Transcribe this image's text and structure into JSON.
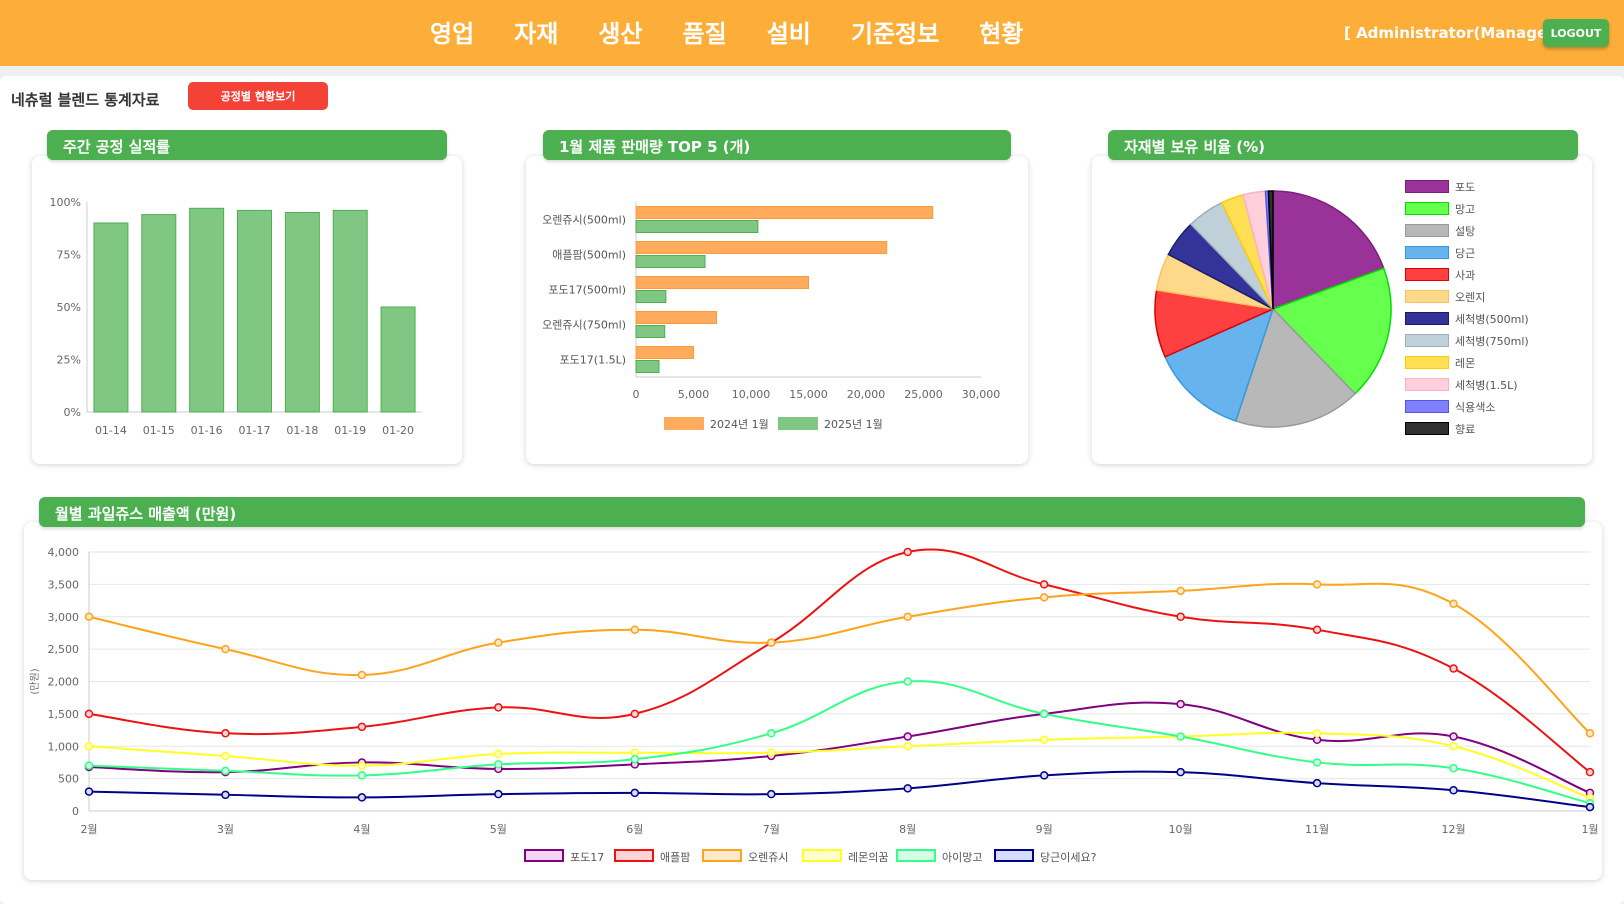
{
  "nav": [
    "영업",
    "자재",
    "생산",
    "품질",
    "설비",
    "기준정보",
    "현황"
  ],
  "user": "[ Administrator(Manager) ]",
  "logout_label": "LOGOUT",
  "page_title": "네츄럴 블렌드 통계자료",
  "process_button_label": "공정별 현황보기",
  "chart_data": [
    {
      "type": "bar",
      "title": "주간 공정 실적률",
      "categories": [
        "01-14",
        "01-15",
        "01-16",
        "01-17",
        "01-18",
        "01-19",
        "01-20"
      ],
      "values": [
        90,
        94,
        97,
        96,
        95,
        96,
        50
      ],
      "ylim": [
        0,
        100
      ],
      "yticks": [
        "0%",
        "25%",
        "50%",
        "75%",
        "100%"
      ],
      "color": "#81c784",
      "edge_color": "#4caf50",
      "grid": false
    },
    {
      "type": "bar",
      "orientation": "horizontal",
      "title": "1월 제품 판매량 TOP 5 (개)",
      "categories": [
        "오렌쥬시(500ml)",
        "애플팜(500ml)",
        "포도17(500ml)",
        "오렌쥬시(750ml)",
        "포도17(1.5L)"
      ],
      "series": [
        {
          "name": "2024년 1월",
          "color": "#ffab5e",
          "values": [
            25800,
            21800,
            15000,
            7000,
            5000
          ]
        },
        {
          "name": "2025년 1월",
          "color": "#81c784",
          "values": [
            10600,
            6000,
            2600,
            2500,
            2000
          ]
        }
      ],
      "xlim": [
        0,
        30000
      ],
      "xticks": [
        "0",
        "5,000",
        "10,000",
        "15,000",
        "20,000",
        "25,000",
        "30,000"
      ],
      "legend": "bottom"
    },
    {
      "type": "pie",
      "title": "자재별 보유 비율 (%)",
      "labels": [
        "포도",
        "망고",
        "설탕",
        "당근",
        "사과",
        "오렌지",
        "세척병(500ml)",
        "세척병(750ml)",
        "레몬",
        "세척병(1.5L)",
        "식용색소",
        "향료"
      ],
      "values": [
        19,
        18,
        17,
        13,
        9,
        5,
        5,
        5,
        3,
        3,
        0.4,
        0.6
      ],
      "colors": [
        "#993399",
        "#66ff4d",
        "#b8b8b8",
        "#66b3ee",
        "#ff4040",
        "#ffd98a",
        "#333399",
        "#c0d0d8",
        "#ffe055",
        "#ffd0dc",
        "#8080ff",
        "#303030"
      ],
      "edge_colors": [
        "#7a1f7a",
        "#00dd00",
        "#9a9a9a",
        "#3399dd",
        "#dd0000",
        "#ffc060",
        "#1a1a66",
        "#9ab0bb",
        "#ffcc00",
        "#ffb0c4",
        "#5555ee",
        "#000000"
      ],
      "legend": "right"
    },
    {
      "type": "line",
      "title": "월별 과일쥬스 매출액 (만원)",
      "ylabel": "(만원)",
      "x": [
        "2월",
        "3월",
        "4월",
        "5월",
        "6월",
        "7월",
        "8월",
        "9월",
        "10월",
        "11월",
        "12월",
        "1월"
      ],
      "ylim": [
        0,
        4000
      ],
      "yticks": [
        "0",
        "500",
        "1,000",
        "1,500",
        "2,000",
        "2,500",
        "3,000",
        "3,500",
        "4,000"
      ],
      "series": [
        {
          "name": "포도17",
          "color": "#800080",
          "fill": "#f6d4f6",
          "values": [
            680,
            600,
            750,
            650,
            720,
            850,
            1150,
            1500,
            1650,
            1100,
            1150,
            280
          ]
        },
        {
          "name": "애플팜",
          "color": "#ee1111",
          "fill": "#ffd4d4",
          "values": [
            1500,
            1200,
            1300,
            1600,
            1500,
            2600,
            4000,
            3500,
            3000,
            2800,
            2200,
            600
          ]
        },
        {
          "name": "오렌쥬시",
          "color": "#ffa31a",
          "fill": "#ffe8cc",
          "values": [
            3000,
            2500,
            2100,
            2600,
            2800,
            2600,
            3000,
            3300,
            3400,
            3500,
            3200,
            1200
          ]
        },
        {
          "name": "레몬의꿈",
          "color": "#ffff22",
          "fill": "#ffffcc",
          "values": [
            1000,
            850,
            700,
            880,
            900,
            900,
            1000,
            1100,
            1150,
            1200,
            1000,
            200
          ]
        },
        {
          "name": "아이망고",
          "color": "#33ff88",
          "fill": "#d4ffe4",
          "values": [
            700,
            620,
            550,
            720,
            800,
            1200,
            2000,
            1500,
            1150,
            750,
            660,
            120
          ]
        },
        {
          "name": "당근이세요?",
          "color": "#000088",
          "fill": "#d4dcff",
          "values": [
            300,
            250,
            210,
            260,
            280,
            260,
            350,
            550,
            600,
            430,
            320,
            60
          ]
        }
      ],
      "legend": "bottom",
      "grid": "horizontal"
    }
  ]
}
